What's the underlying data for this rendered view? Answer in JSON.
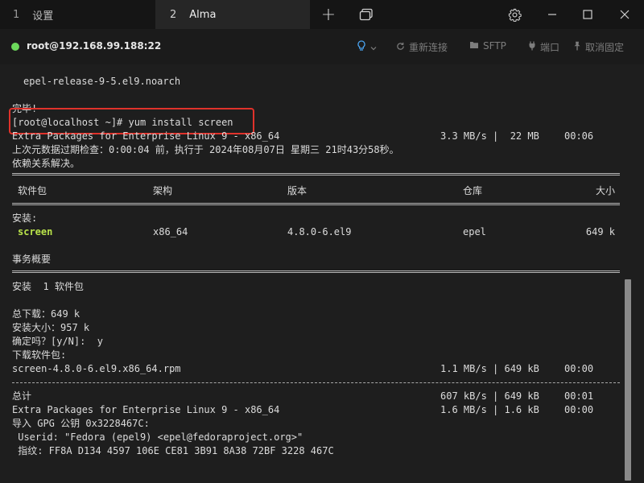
{
  "tabs": [
    {
      "num": "1",
      "label": "设置"
    },
    {
      "num": "2",
      "label": "Alma"
    }
  ],
  "window_controls": {
    "new_tab": "+",
    "minimize": "—",
    "maximize": "☐",
    "close": "✕"
  },
  "connection": {
    "host": "root@192.168.99.188:22",
    "status_color": "#6cd95b",
    "actions": {
      "reconnect": "重新连接",
      "sftp": "SFTP",
      "port": "端口",
      "unpin": "取消固定"
    }
  },
  "terminal": {
    "lines": {
      "l1": "epel-release-9-5.el9.noarch",
      "l2": "完毕!",
      "l3": "[root@localhost ~]# yum install screen",
      "l4a": "Extra Packages for Enterprise Linux 9 - x86_64",
      "l4b": "3.3 MB/s |  22 MB",
      "l4c": "00:06",
      "l5": "上次元数据过期检查：0:00:04 前，执行于 2024年08月07日 星期三 21时43分58秒。",
      "l6": "依赖关系解决。",
      "l10": "安装:",
      "l13": "事务概要",
      "l15": "安装  1 软件包",
      "l17": "总下载：649 k",
      "l18": "安装大小：957 k",
      "l19": "确定吗？[y/N]:  y",
      "l20": "下载软件包:",
      "l21a": "screen-4.8.0-6.el9.x86_64.rpm",
      "l21b": "1.1 MB/s | 649 kB",
      "l21c": "00:00",
      "l23a": "总计",
      "l23b": "607 kB/s | 649 kB",
      "l23c": "00:01",
      "l24a": "Extra Packages for Enterprise Linux 9 - x86_64",
      "l24b": "1.6 MB/s | 1.6 kB",
      "l24c": "00:00",
      "l25": "导入 GPG 公钥 0x3228467C:",
      "l26": " Userid: \"Fedora (epel9) <epel@fedoraproject.org>\"",
      "l27": " 指纹: FF8A D134 4597 106E CE81 3B91 8A38 72BF 3228 467C"
    },
    "table": {
      "headers": {
        "package": "软件包",
        "arch": "架构",
        "version": "版本",
        "repo": "仓库",
        "size": "大小"
      },
      "row": {
        "package": "screen",
        "arch": "x86_64",
        "version": "4.8.0-6.el9",
        "repo": "epel",
        "size": "649 k"
      }
    }
  },
  "colors": {
    "highlight_box": "#e0322b",
    "package_name": "#b9e34a",
    "background": "#1e1e1e"
  }
}
